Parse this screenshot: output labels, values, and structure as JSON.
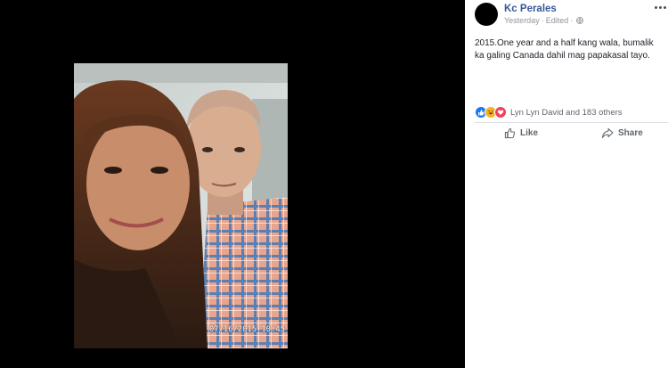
{
  "photo": {
    "timestamp": "07/16/2015 10:45"
  },
  "post": {
    "author": "Kc Perales",
    "time": "Yesterday",
    "edited": "Edited",
    "separator": "·",
    "text": "2015.One year and a half kang wala, bumalik ka galing Canada dahil mag papakasal tayo.",
    "privacy_icon": "globe-icon"
  },
  "reactions": {
    "icons": [
      "like-icon",
      "haha-icon",
      "love-icon"
    ],
    "summary": "Lyn Lyn David and 183 others"
  },
  "actions": {
    "like_label": "Like",
    "share_label": "Share"
  },
  "colors": {
    "author": "#385898",
    "meta": "#90949c",
    "like_blue": "#1877f2",
    "love_red": "#f33e58",
    "haha_yellow": "#f7b125"
  }
}
